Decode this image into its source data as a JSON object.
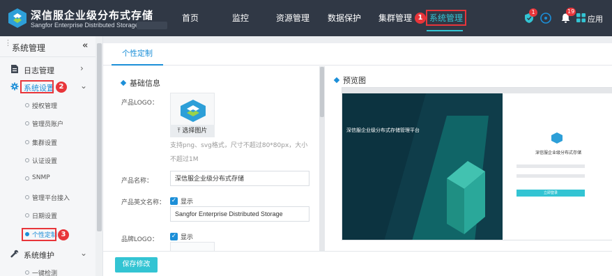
{
  "brand": {
    "name_cn": "深信服企业级分布式存储",
    "name_en": "Sangfor Enterprise Distributed Storage",
    "logo_icon": "sangfor-logo-icon"
  },
  "top_nav": {
    "items": [
      "首页",
      "监控",
      "资源管理",
      "数据保护",
      "集群管理",
      "系统管理"
    ],
    "active": "系统管理",
    "step_badge": "1",
    "alerts": {
      "shield_count": "1",
      "bell_count": "19"
    },
    "apps_label": "应用"
  },
  "sidebar": {
    "title": "系统管理",
    "collapse_glyph": "«",
    "groups": [
      {
        "label": "日志管理",
        "icon": "document-icon",
        "chevron": "›"
      },
      {
        "label": "系统设置",
        "icon": "gear-icon",
        "chevron": "⌄",
        "step_badge": "2"
      },
      {
        "label": "系统维护",
        "icon": "wrench-icon",
        "chevron": "⌄"
      }
    ],
    "sub_items": [
      "授权管理",
      "管理员账户",
      "集群设置",
      "认证设置",
      "SNMP",
      "管理平台接入",
      "日期设置",
      "个性定制",
      "一键检测"
    ],
    "active_sub": "个性定制",
    "active_step_badge": "3"
  },
  "tabs": {
    "active_tab": "个性定制"
  },
  "basic_info": {
    "section_title": "基础信息",
    "product_logo_label": "产品LOGO：",
    "upload_label": "选择图片",
    "upload_hint": "支持png、svg格式，尺寸不超过80*80px，大小不超过1M",
    "product_name_label": "产品名称：",
    "product_name_value": "深信服企业级分布式存储",
    "product_en_label": "产品英文名称：",
    "show_label": "显示",
    "product_en_value": "Sangfor Enterprise Distributed Storage",
    "brand_logo_label": "品牌LOGO：",
    "brand_show_label": "显示"
  },
  "preview": {
    "section_title": "预览图",
    "banner_title": "深信服企业级分布式存储管理平台",
    "login_title": "深信服企业级分布式存储",
    "login_button": "立即登录"
  },
  "footer": {
    "save_label": "保存修改"
  },
  "colors": {
    "topbar": "#303845",
    "accent": "#33c4d3",
    "link_blue": "#1c8fd8",
    "annotation_red": "#e8353a"
  }
}
